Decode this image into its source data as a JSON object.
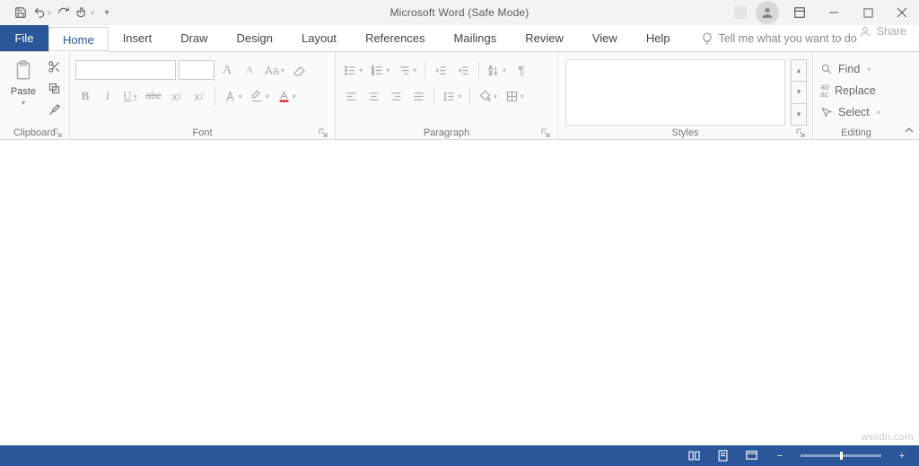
{
  "title": "Microsoft Word (Safe Mode)",
  "tabs": {
    "file": "File",
    "home": "Home",
    "insert": "Insert",
    "draw": "Draw",
    "design": "Design",
    "layout": "Layout",
    "references": "References",
    "mailings": "Mailings",
    "review": "Review",
    "view": "View",
    "help": "Help"
  },
  "tellme": "Tell me what you want to do",
  "share": "Share",
  "groups": {
    "clipboard": "Clipboard",
    "font": "Font",
    "paragraph": "Paragraph",
    "styles": "Styles",
    "editing": "Editing"
  },
  "clipboard": {
    "paste": "Paste"
  },
  "font": {
    "grow": "A",
    "shrink": "A",
    "case": "Aa",
    "bold": "B",
    "italic": "I",
    "underline": "U",
    "strike": "abc",
    "sub": "x",
    "sup": "x"
  },
  "editing": {
    "find": "Find",
    "replace": "Replace",
    "select": "Select"
  },
  "watermark": "wsxdn.com"
}
